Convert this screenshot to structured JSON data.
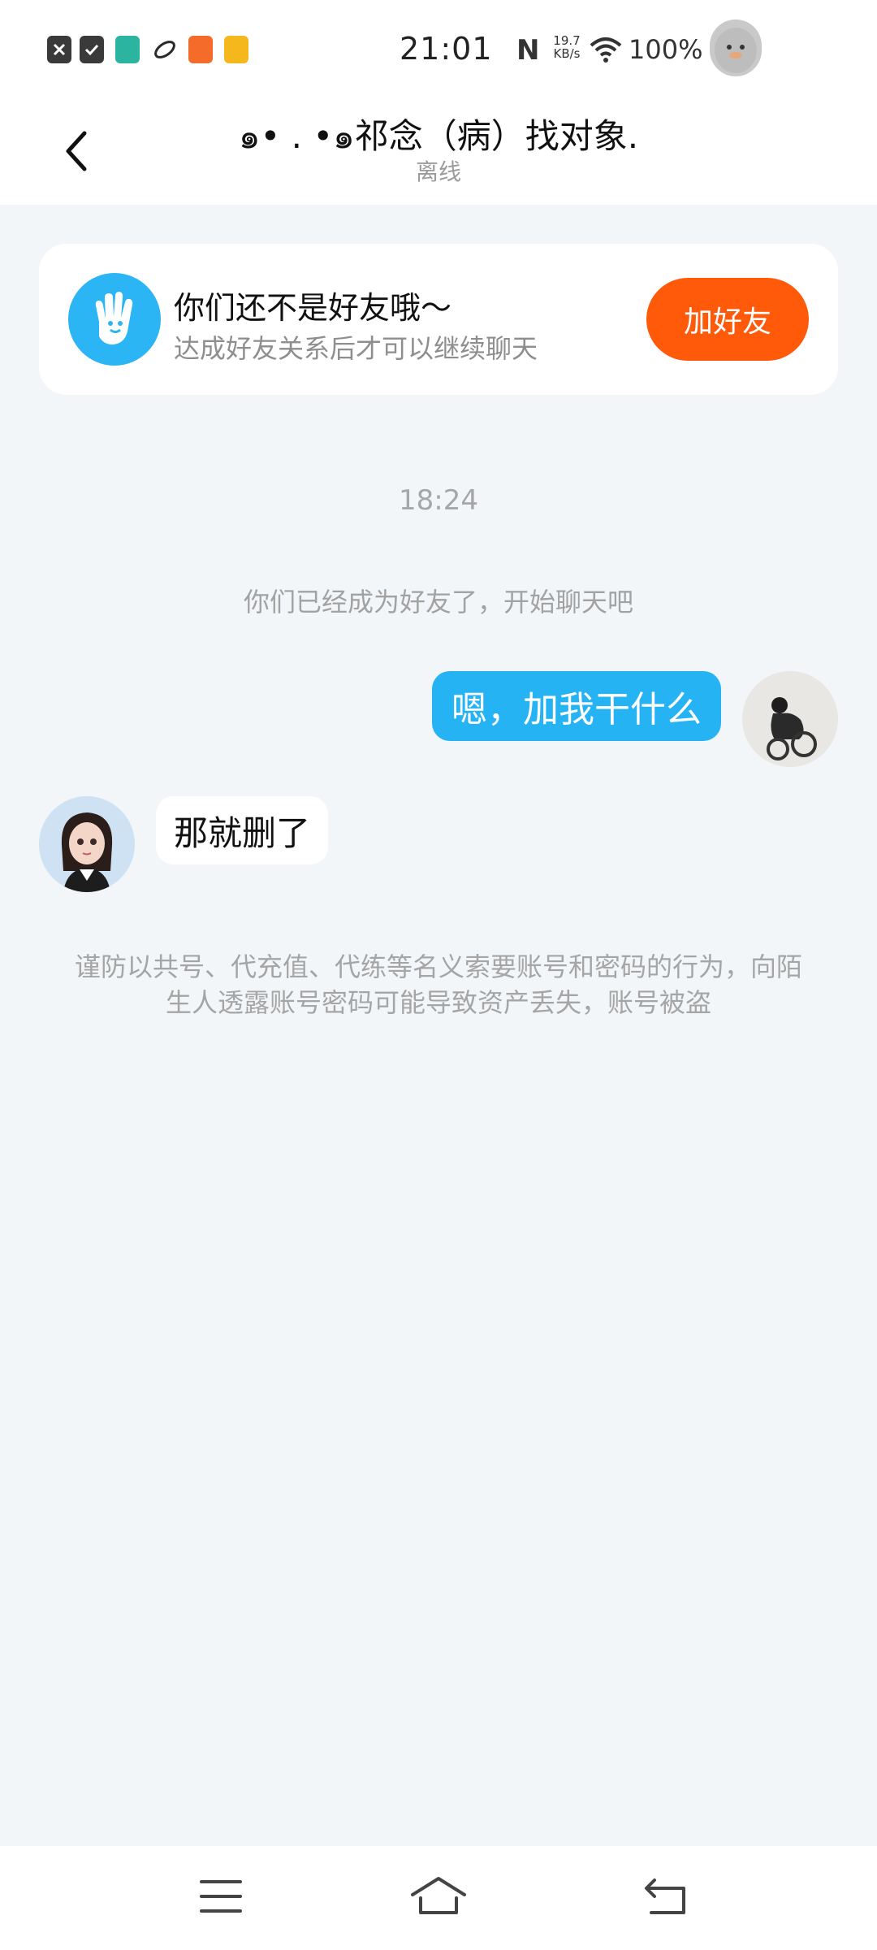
{
  "status_bar": {
    "time": "21:01",
    "nfc": "N",
    "net_speed_value": "19.7",
    "net_speed_unit": "KB/s",
    "battery": "100%",
    "app_icon_colors": [
      "#333333",
      "#333333",
      "#2bb5a0",
      "#2a2a2a",
      "#f56b2a",
      "#f5b81c"
    ]
  },
  "header": {
    "title": "๑• . •๑祁念（病）找对象.",
    "status": "离线"
  },
  "friend_card": {
    "title": "你们还不是好友哦～",
    "subtitle": "达成好友关系后才可以继续聊天",
    "button_label": "加好友"
  },
  "chat": {
    "timestamp": "18:24",
    "system_message": "你们已经成为好友了，开始聊天吧",
    "messages": [
      {
        "side": "right",
        "text": "嗯，加我干什么"
      },
      {
        "side": "left",
        "text": "那就删了"
      }
    ],
    "warning": "谨防以共号、代充值、代练等名义索要账号和密码的行为，向陌生人透露账号密码可能导致资产丢失，账号被盗"
  },
  "nav_bar": {
    "icons": [
      "menu-icon",
      "home-icon",
      "back-icon"
    ]
  },
  "colors": {
    "accent_blue": "#26b3f4",
    "add_friend_orange": "#fe5a0a",
    "background": "#f3f6f9"
  }
}
